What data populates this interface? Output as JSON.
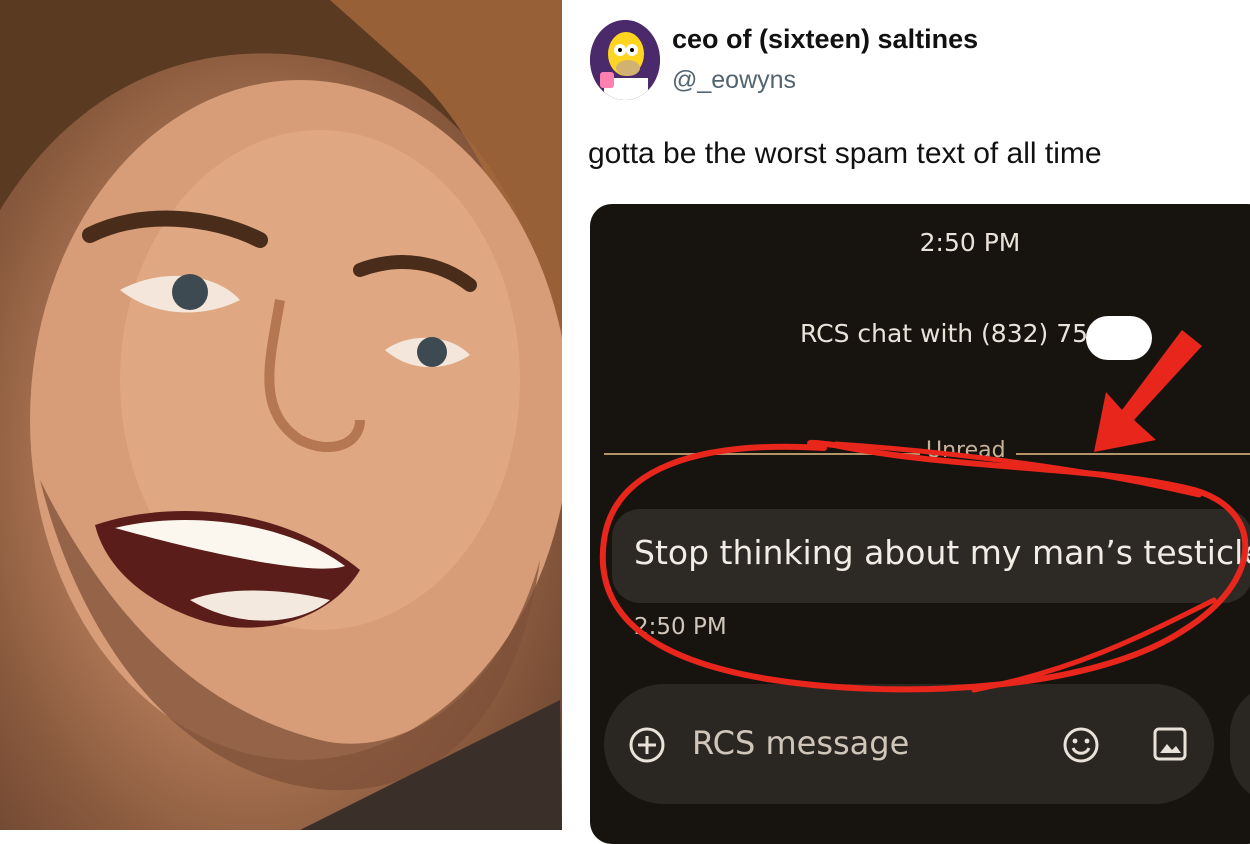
{
  "photo": {
    "alt_subject": "smiling-man-photo"
  },
  "tweet": {
    "display_name": "ceo of (sixteen) saltines",
    "handle": "@_eowyns",
    "text": "gotta be the worst spam text of all time"
  },
  "phone": {
    "top_timestamp": "2:50 PM",
    "rcs_chat_label": "RCS chat with (832) 752-",
    "unread_label": "Unread",
    "message_text": "Stop thinking about my man’s testicles!",
    "message_timestamp": "2:50 PM",
    "compose_placeholder": "RCS message",
    "icons": [
      "add-circle-icon",
      "emoji-icon",
      "image-icon"
    ]
  },
  "colors": {
    "annotation_red": "#e8261c",
    "phone_bg": "#171410",
    "bubble_bg": "#2d2a25",
    "divider_line": "#b6946a"
  }
}
